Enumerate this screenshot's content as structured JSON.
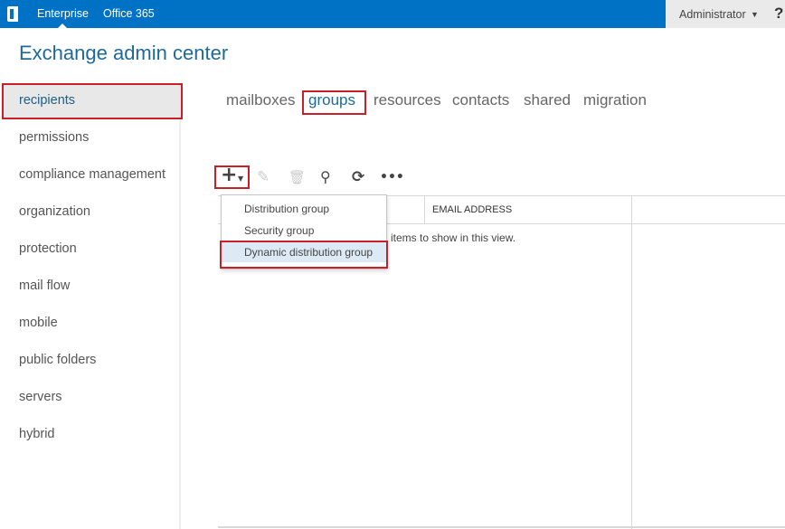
{
  "topbar": {
    "logo_icon": "office-logo-icon",
    "links": [
      "Enterprise",
      "Office 365"
    ],
    "user": "Administrator",
    "help": "?"
  },
  "title": "Exchange admin center",
  "sidebar": {
    "items": [
      {
        "label": "recipients",
        "selected": true
      },
      {
        "label": "permissions"
      },
      {
        "label": "compliance management"
      },
      {
        "label": "organization"
      },
      {
        "label": "protection"
      },
      {
        "label": "mail flow"
      },
      {
        "label": "mobile"
      },
      {
        "label": "public folders"
      },
      {
        "label": "servers"
      },
      {
        "label": "hybrid"
      }
    ]
  },
  "tabs": [
    {
      "label": "mailboxes"
    },
    {
      "label": "groups",
      "selected": true
    },
    {
      "label": "resources"
    },
    {
      "label": "contacts"
    },
    {
      "label": "shared"
    },
    {
      "label": "migration"
    }
  ],
  "toolbar": {
    "icons": [
      "add-icon",
      "edit-icon",
      "delete-icon",
      "search-icon",
      "refresh-icon",
      "more-icon"
    ]
  },
  "table": {
    "columns": [
      "EMAIL ADDRESS"
    ],
    "empty_message": "items to show in this view."
  },
  "menu": {
    "items": [
      "Distribution group",
      "Security group",
      "Dynamic distribution group"
    ],
    "highlighted": "Dynamic distribution group"
  },
  "colors": {
    "accent": "#0072c6",
    "highlight_box": "#c8202b",
    "title": "#1d6a9a"
  }
}
